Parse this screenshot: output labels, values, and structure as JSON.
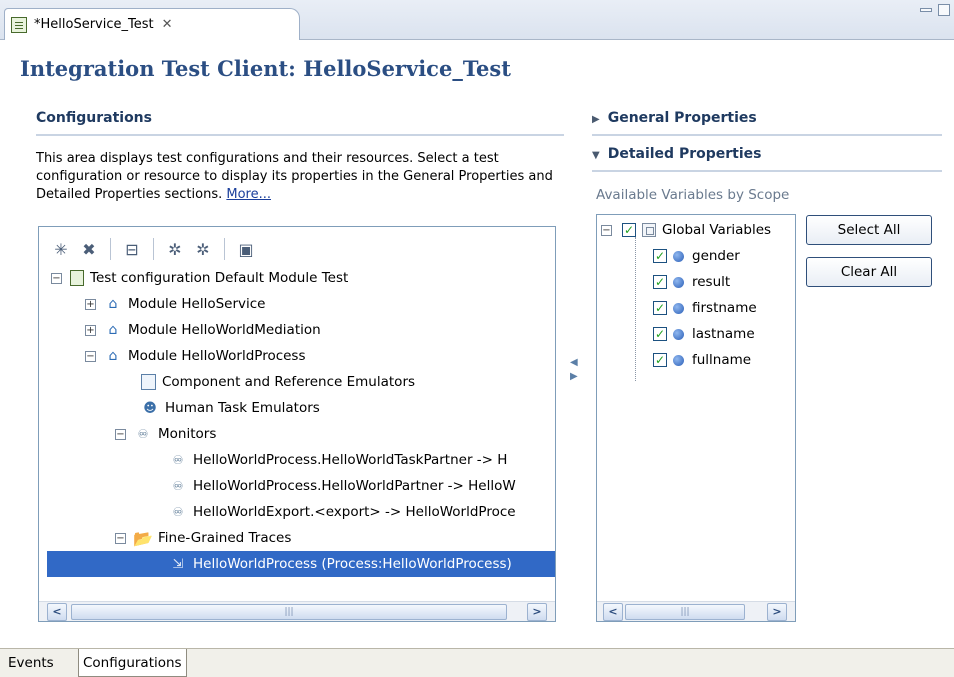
{
  "editor": {
    "tab_label": "*HelloService_Test",
    "close_glyph": "✕",
    "page_title": "Integration Test Client: HelloService_Test"
  },
  "configurations": {
    "heading": "Configurations",
    "description": "This area displays test configurations and their resources. Select a test configuration or resource to display its properties in the General Properties and Detailed Properties sections.",
    "more_link": "More..."
  },
  "toolbar": {
    "icons": [
      "new-configuration-icon",
      "remove-icon",
      "collapse-all-icon",
      "emulate-icon",
      "monitor-icon",
      "save-icon"
    ]
  },
  "tree": {
    "root": "Test configuration Default Module Test",
    "module_1": "Module HelloService",
    "module_2": "Module HelloWorldMediation",
    "module_3": "Module HelloWorldProcess",
    "emulators": "Component and Reference Emulators",
    "human_task": "Human Task Emulators",
    "monitors": "Monitors",
    "monitor_1": "HelloWorldProcess.HelloWorldTaskPartner -> H",
    "monitor_2": "HelloWorldProcess.HelloWorldPartner -> HelloW",
    "monitor_3": "HelloWorldExport.<export> -> HelloWorldProce",
    "traces": "Fine-Grained Traces",
    "trace_1": "HelloWorldProcess (Process:HelloWorldProcess)"
  },
  "right": {
    "general_heading": "General Properties",
    "detailed_heading": "Detailed Properties",
    "available_label": "Available Variables by Scope",
    "scope": "Global Variables",
    "variables": [
      "gender",
      "result",
      "firstname",
      "lastname",
      "fullname"
    ],
    "select_all": "Select All",
    "clear_all": "Clear All"
  },
  "bottom_tabs": {
    "events": "Events",
    "configurations": "Configurations"
  },
  "colors": {
    "title": "#2b4e83",
    "selection": "#3169c6",
    "link": "#1a3e9b"
  }
}
